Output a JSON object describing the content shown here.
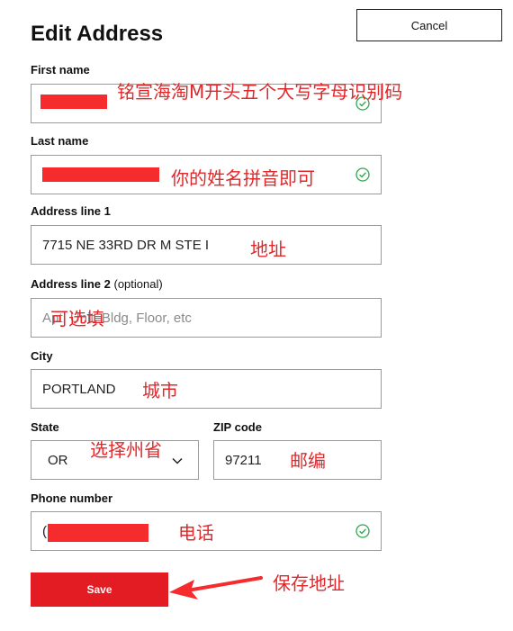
{
  "header": {
    "title": "Edit Address",
    "cancel_label": "Cancel"
  },
  "fields": {
    "first_name": {
      "label": "First name"
    },
    "last_name": {
      "label": "Last name"
    },
    "address1": {
      "label": "Address line 1",
      "value": "7715 NE 33RD DR M STE I"
    },
    "address2": {
      "label": "Address line 2",
      "optional": "(optional)",
      "placeholder": "Apt, Unit, Bldg, Floor, etc"
    },
    "city": {
      "label": "City",
      "value": "PORTLAND"
    },
    "state": {
      "label": "State",
      "value": "OR"
    },
    "zip": {
      "label": "ZIP code",
      "value": "97211"
    },
    "phone": {
      "label": "Phone number",
      "value": "("
    }
  },
  "save_label": "Save",
  "annotations": {
    "first_name": "铭宣海淘M开头五个大写字母识别码",
    "last_name": "你的姓名拼音即可",
    "address1": "地址",
    "address2": "可选填",
    "city": "城市",
    "state": "选择州省",
    "zip": "邮编",
    "phone": "电话",
    "save": "保存地址"
  },
  "colors": {
    "accent": "#e31b23",
    "valid": "#2fa84f",
    "annotation": "#e0282b"
  }
}
